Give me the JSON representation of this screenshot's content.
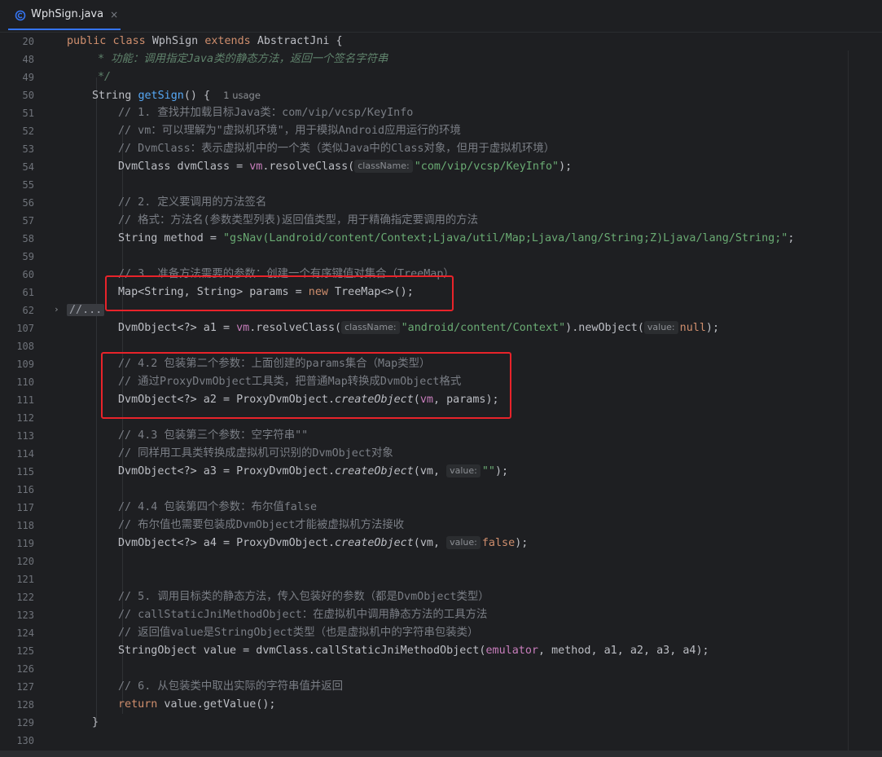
{
  "tab": {
    "icon": "java-class-icon",
    "label": "WphSign.java",
    "close": "×",
    "accent": "#3574f0"
  },
  "sticky": {
    "line": "20",
    "public": "public",
    "class": "class",
    "name": "WphSign",
    "extends": "extends",
    "parent": "AbstractJni",
    "brace": " {"
  },
  "lines": {
    "n48": "48",
    "n49": "49",
    "n50": "50",
    "n51": "51",
    "n52": "52",
    "n53": "53",
    "n54": "54",
    "n55": "55",
    "n56": "56",
    "n57": "57",
    "n58": "58",
    "n59": "59",
    "n60": "60",
    "n61": "61",
    "n62": "62",
    "n107": "107",
    "n108": "108",
    "n109": "109",
    "n110": "110",
    "n111": "111",
    "n112": "112",
    "n113": "113",
    "n114": "114",
    "n115": "115",
    "n116": "116",
    "n117": "117",
    "n118": "118",
    "n119": "119",
    "n120": "120",
    "n121": "121",
    "n122": "122",
    "n123": "123",
    "n124": "124",
    "n125": "125",
    "n126": "126",
    "n127": "127",
    "n128": "128",
    "n129": "129",
    "n130": "130"
  },
  "code": {
    "l48": "* 功能：调用指定Java类的静态方法，返回一个签名字符串",
    "l49": "*/",
    "l50_type": "String ",
    "l50_fn": "getSign",
    "l50_rest": "() {",
    "l50_usage": "1 usage",
    "l51": "// 1. 查找并加载目标Java类：com/vip/vcsp/KeyInfo",
    "l52": "// vm：可以理解为\"虚拟机环境\"，用于模拟Android应用运行的环境",
    "l53": "// DvmClass：表示虚拟机中的一个类（类似Java中的Class对象，但用于虚拟机环境）",
    "l54_a": "DvmClass dvmClass = ",
    "l54_vm": "vm",
    "l54_b": ".resolveClass(",
    "l54_hint": "className:",
    "l54_str": "\"com/vip/vcsp/KeyInfo\"",
    "l54_c": ");",
    "l56": "// 2. 定义要调用的方法签名",
    "l57": "// 格式：方法名(参数类型列表)返回值类型，用于精确指定要调用的方法",
    "l58_a": "String method = ",
    "l58_str": "\"gsNav(Landroid/content/Context;Ljava/util/Map;Ljava/lang/String;Z)Ljava/lang/String;\"",
    "l58_c": ";",
    "l60": "// 3. 准备方法需要的参数：创建一个有序键值对集合（TreeMap）",
    "l61_a": "Map<String, String> params = ",
    "l61_new": "new",
    "l61_b": " TreeMap<>();",
    "l62": "//...",
    "l107_a": "DvmObject<?> a1 = ",
    "l107_vm": "vm",
    "l107_b": ".resolveClass(",
    "l107_hint": "className:",
    "l107_str": "\"android/content/Context\"",
    "l107_c": ").newObject(",
    "l107_hint2": "value:",
    "l107_null": "null",
    "l107_d": ");",
    "l109": "// 4.2 包装第二个参数：上面创建的params集合（Map类型）",
    "l110": "// 通过ProxyDvmObject工具类，把普通Map转换成DvmObject格式",
    "l111_a": "DvmObject<?> a2 = ProxyDvmObject.",
    "l111_fn": "createObject",
    "l111_b": "(",
    "l111_vm": "vm",
    "l111_c": ", params);",
    "l113": "// 4.3 包装第三个参数：空字符串\"\"",
    "l114": "// 同样用工具类转换成虚拟机可识别的DvmObject对象",
    "l115_a": "DvmObject<?> a3 = ProxyDvmObject.",
    "l115_fn": "createObject",
    "l115_b": "(vm, ",
    "l115_hint": "value:",
    "l115_str": "\"\"",
    "l115_c": ");",
    "l117": "// 4.4 包装第四个参数：布尔值false",
    "l118": "// 布尔值也需要包装成DvmObject才能被虚拟机方法接收",
    "l119_a": "DvmObject<?> a4 = ProxyDvmObject.",
    "l119_fn": "createObject",
    "l119_b": "(vm, ",
    "l119_hint": "value:",
    "l119_kw": "false",
    "l119_c": ");",
    "l122": "// 5. 调用目标类的静态方法，传入包装好的参数（都是DvmObject类型）",
    "l123": "// callStaticJniMethodObject：在虚拟机中调用静态方法的工具方法",
    "l124": "// 返回值value是StringObject类型（也是虚拟机中的字符串包装类）",
    "l125_a": "StringObject value = dvmClass.callStaticJniMethodObject(",
    "l125_field": "emulator",
    "l125_b": ", method, a1, a2, a3, a4);",
    "l127": "// 6. 从包装类中取出实际的字符串值并返回",
    "l128_kw": "return",
    "l128_b": " value.getValue();",
    "l129": "}"
  },
  "colors": {
    "background": "#1e1f22",
    "keyword": "#cf8e6d",
    "function": "#56a8f5",
    "string": "#6aab73",
    "comment": "#7a7e85",
    "highlight_box": "#e8232a"
  }
}
